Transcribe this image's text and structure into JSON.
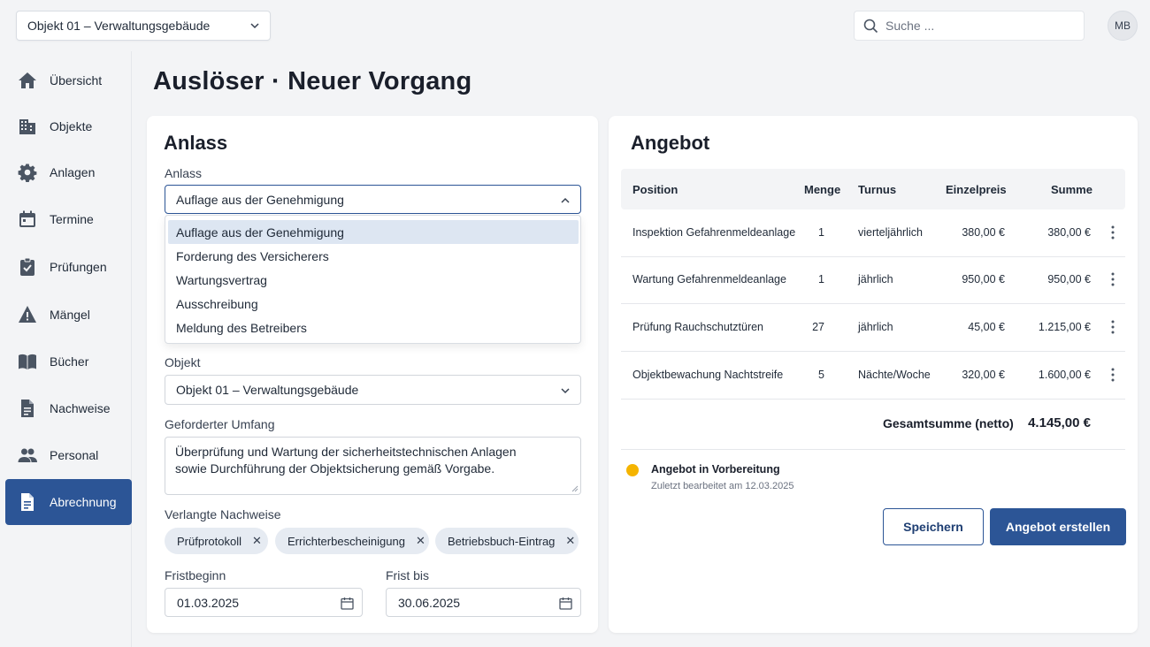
{
  "topbar": {
    "object_select": "Objekt 01 – Verwaltungsgebäude",
    "search_placeholder": "Suche ...",
    "avatar_initials": "MB"
  },
  "sidebar": {
    "items": [
      {
        "label": "Übersicht",
        "icon": "home-icon"
      },
      {
        "label": "Objekte",
        "icon": "building-icon"
      },
      {
        "label": "Anlagen",
        "icon": "gear-icon"
      },
      {
        "label": "Termine",
        "icon": "calendar-icon"
      },
      {
        "label": "Prüfungen",
        "icon": "clipboard-check-icon"
      },
      {
        "label": "Mängel",
        "icon": "warning-icon"
      },
      {
        "label": "Bücher",
        "icon": "book-icon"
      },
      {
        "label": "Nachweise",
        "icon": "document-icon"
      },
      {
        "label": "Personal",
        "icon": "people-icon"
      },
      {
        "label": "Abrechnung",
        "icon": "invoice-icon",
        "active": true
      }
    ]
  },
  "page": {
    "title": "Auslöser · Neuer Vorgang"
  },
  "anlass": {
    "title": "Anlass",
    "anlass_label": "Anlass",
    "anlass_value": "Auflage aus der Genehmigung",
    "options": [
      "Auflage aus der Genehmigung",
      "Forderung des Versicherers",
      "Wartungsvertrag",
      "Ausschreibung",
      "Meldung des Betreibers"
    ],
    "selected_option_index": 0,
    "objekt_label": "Objekt",
    "objekt_value": "Objekt 01 – Verwaltungsgebäude",
    "umfang_label": "Geforderter Umfang",
    "umfang_lines": [
      "Überprüfung und Wartung der sicherheitstechnischen Anlagen",
      "sowie Durchführung der Objektsicherung gemäß Vorgabe."
    ],
    "nachweise_label": "Verlangte Nachweise",
    "nachweise": [
      "Prüfprotokoll",
      "Errichterbescheinigung",
      "Betriebsbuch-Eintrag"
    ],
    "chip_remove": "✕",
    "fristbeginn_label": "Fristbeginn",
    "fristbeginn_value": "01.03.2025",
    "frist_bis_label": "Frist bis",
    "frist_bis_value": "30.06.2025"
  },
  "angebot": {
    "title": "Angebot",
    "columns": [
      "Position",
      "Menge",
      "Turnus",
      "Einzelpreis",
      "Summe"
    ],
    "rows": [
      {
        "position": "Inspektion Gefahrenmeldeanlage",
        "menge": "1",
        "turnus": "vierteljährlich",
        "einzelpreis": "380,00 €",
        "summe": "380,00 €"
      },
      {
        "position": "Wartung Gefahrenmeldeanlage",
        "menge": "1",
        "turnus": "jährlich",
        "einzelpreis": "950,00 €",
        "summe": "950,00 €"
      },
      {
        "position": "Prüfung Rauchschutztüren",
        "menge": "27",
        "turnus": "jährlich",
        "einzelpreis": "45,00 €",
        "summe": "1.215,00 €"
      },
      {
        "position": "Objektbewachung Nachtstreife",
        "menge": "5",
        "turnus": "Nächte/Woche",
        "einzelpreis": "320,00 €",
        "summe": "1.600,00 €"
      }
    ],
    "total_label": "Gesamtsumme (netto)",
    "total_value": "4.145,00 €",
    "status_title": "Angebot in Vorbereitung",
    "status_sub": "Zuletzt bearbeitet am 12.03.2025",
    "status_color": "#f5b400",
    "save_label": "Speichern",
    "create_label": "Angebot erstellen"
  },
  "colors": {
    "accent": "#2c5596",
    "chip_bg": "#e6ebf2",
    "dropdown_selected": "#dde6f2"
  }
}
